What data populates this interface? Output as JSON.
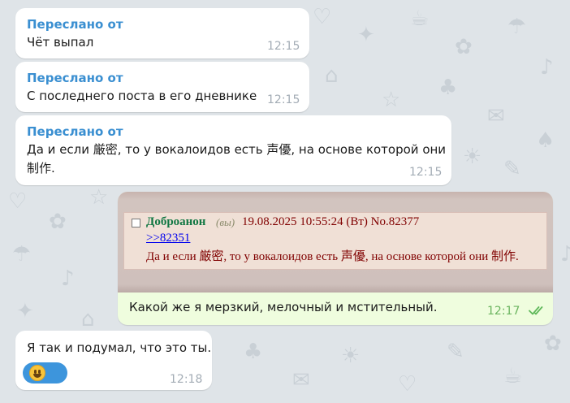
{
  "messages": [
    {
      "forwarded_label": "Переслано от",
      "text": "Чёт выпал",
      "time": "12:15"
    },
    {
      "forwarded_label": "Переслано от",
      "text": "С последнего поста в его дневнике",
      "time": "12:15"
    },
    {
      "forwarded_label": "Переслано от",
      "text_line1": "Да и если 厳密, то у вокалоидов есть 声優, на основе которой они",
      "text_line2": "制作.",
      "time": "12:15"
    }
  ],
  "outgoing": {
    "post": {
      "name": "Доброанон",
      "you_tag": "(вы)",
      "meta": "19.08.2025 10:55:24 (Вт) No.82377",
      "reply_link": ">>82351",
      "text": "Да и если 厳密, то у вокалоидов есть 声優, на основе которой они 制作."
    },
    "caption": "Какой же я мерзкий, мелочный и мстительный.",
    "time": "12:17",
    "status_icon": "double-check-icon"
  },
  "reply_message": {
    "text": "Я так и подумал, что это ты.",
    "reaction_icon": "grinning-face-emoji",
    "time": "12:18"
  },
  "colors": {
    "forward_label": "#3a8fd1",
    "outgoing_bubble": "#effdde",
    "check_marks": "#5fb85a",
    "reaction_badge": "#3d95dc"
  }
}
